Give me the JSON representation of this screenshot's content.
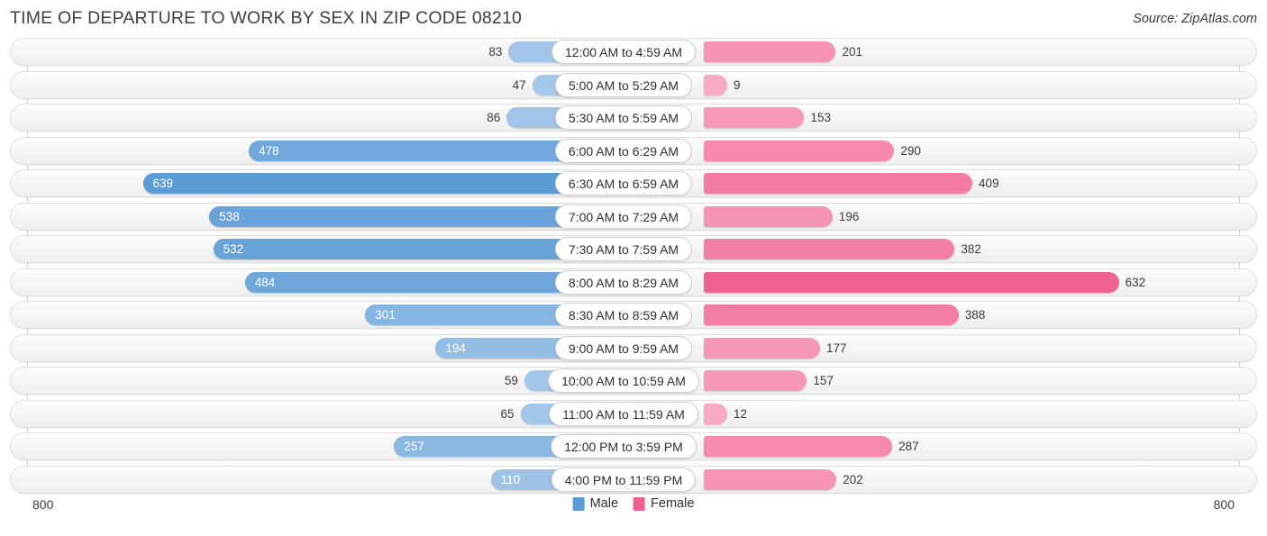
{
  "header": {
    "title": "TIME OF DEPARTURE TO WORK BY SEX IN ZIP CODE 08210",
    "source": "Source: ZipAtlas.com"
  },
  "legend": {
    "male_label": "Male",
    "female_label": "Female",
    "male_color": "#5B9BD5",
    "female_color": "#F0608F"
  },
  "axis": {
    "left_max": "800",
    "right_max": "800"
  },
  "chart_data": {
    "type": "bar",
    "subtype": "diverging-horizontal",
    "title": "TIME OF DEPARTURE TO WORK BY SEX IN ZIP CODE 08210",
    "xlabel": "",
    "ylabel": "",
    "xlim": [
      800,
      800
    ],
    "grid": false,
    "legend_position": "bottom-center",
    "categories": [
      "12:00 AM to 4:59 AM",
      "5:00 AM to 5:29 AM",
      "5:30 AM to 5:59 AM",
      "6:00 AM to 6:29 AM",
      "6:30 AM to 6:59 AM",
      "7:00 AM to 7:29 AM",
      "7:30 AM to 7:59 AM",
      "8:00 AM to 8:29 AM",
      "8:30 AM to 8:59 AM",
      "9:00 AM to 9:59 AM",
      "10:00 AM to 10:59 AM",
      "11:00 AM to 11:59 AM",
      "12:00 PM to 3:59 PM",
      "4:00 PM to 11:59 PM"
    ],
    "series": [
      {
        "name": "Male",
        "color": "#5B9BD5",
        "direction": "left",
        "values": [
          83,
          47,
          86,
          478,
          639,
          538,
          532,
          484,
          301,
          194,
          59,
          65,
          257,
          110
        ]
      },
      {
        "name": "Female",
        "color": "#F0608F",
        "direction": "right",
        "values": [
          201,
          9,
          153,
          290,
          409,
          196,
          382,
          632,
          388,
          177,
          157,
          12,
          287,
          202
        ]
      }
    ]
  }
}
